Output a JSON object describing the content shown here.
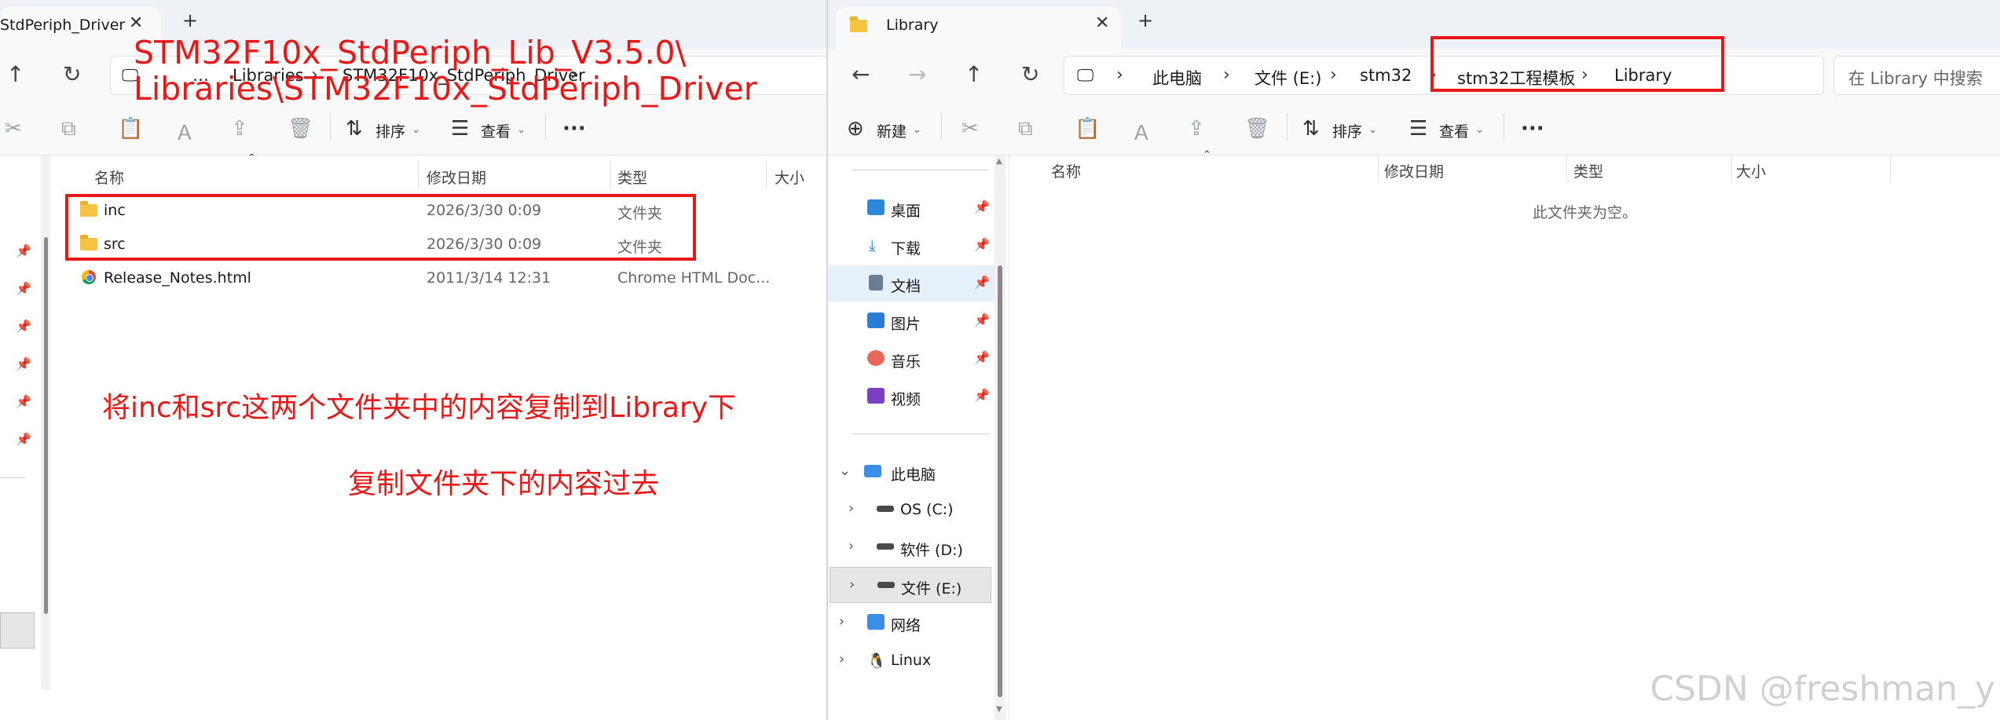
{
  "left": {
    "tab_title": "StdPeriph_Driver",
    "breadcrumb": [
      "…",
      "Libraries",
      "STM32F10x_StdPeriph_Driver"
    ],
    "toolbar": {
      "sort": "排序",
      "view": "查看"
    },
    "columns": [
      "名称",
      "修改日期",
      "类型",
      "大小"
    ],
    "files": [
      {
        "name": "inc",
        "date": "2026/3/30 0:09",
        "type": "文件夹",
        "icon": "folder-icon"
      },
      {
        "name": "src",
        "date": "2026/3/30 0:09",
        "type": "文件夹",
        "icon": "folder-icon"
      },
      {
        "name": "Release_Notes.html",
        "date": "2011/3/14 12:31",
        "type": "Chrome HTML Doc...",
        "icon": "chrome-icon"
      }
    ]
  },
  "right": {
    "tab_title": "Library",
    "breadcrumb": [
      "此电脑",
      "文件 (E:)",
      "stm32",
      "stm32工程模板",
      "Library"
    ],
    "search_placeholder": "在 Library 中搜索",
    "toolbar": {
      "new": "新建",
      "sort": "排序",
      "view": "查看"
    },
    "columns": [
      "名称",
      "修改日期",
      "类型",
      "大小"
    ],
    "empty_text": "此文件夹为空。",
    "quick_access": [
      {
        "label": "桌面",
        "icon": "desktop-icon",
        "color": "#2b88d8"
      },
      {
        "label": "下载",
        "icon": "download-icon",
        "color": "#1f7ac9"
      },
      {
        "label": "文档",
        "icon": "document-icon",
        "color": "#6b7c93"
      },
      {
        "label": "图片",
        "icon": "pictures-icon",
        "color": "#2b7cd3"
      },
      {
        "label": "音乐",
        "icon": "music-icon",
        "color": "#e8685a"
      },
      {
        "label": "视频",
        "icon": "video-icon",
        "color": "#7b3fc0"
      }
    ],
    "this_pc": "此电脑",
    "drives": [
      "OS (C:)",
      "软件 (D:)",
      "文件 (E:)"
    ],
    "network": "网络",
    "linux": "Linux"
  },
  "annotations": {
    "path_line1": "STM32F10x_StdPeriph_Lib_V3.5.0\\",
    "path_line2": "Libraries\\STM32F10x_StdPeriph_Driver",
    "instruction1": "将inc和src这两个文件夹中的内容复制到Library下",
    "instruction2": "复制文件夹下的内容过去"
  },
  "watermark": "CSDN @freshman_y",
  "colors": {
    "annotation_red": "#e81818",
    "selected_bg": "#e5f0fb",
    "drive_selected_bg": "#e6e6e6"
  }
}
